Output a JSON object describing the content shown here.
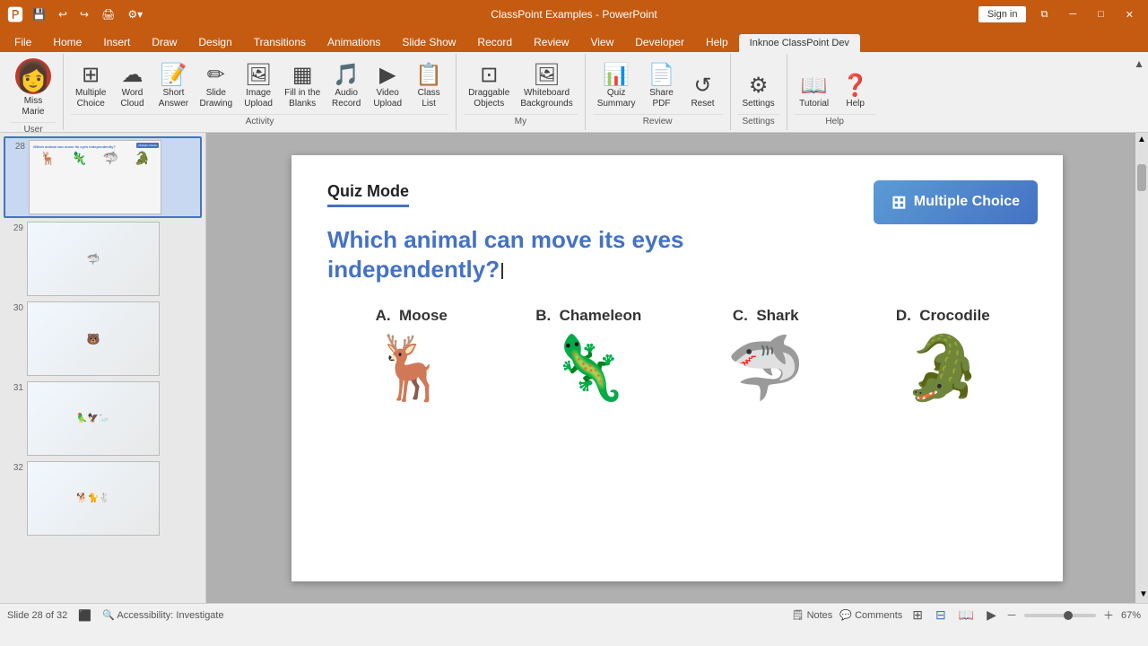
{
  "titleBar": {
    "appName": "ClassPoint Examples - PowerPoint",
    "signIn": "Sign in",
    "qatButtons": [
      "💾",
      "↩",
      "↪",
      "🖨",
      "⚙"
    ]
  },
  "ribbonTabs": [
    {
      "label": "File",
      "active": false
    },
    {
      "label": "Home",
      "active": false
    },
    {
      "label": "Insert",
      "active": false
    },
    {
      "label": "Draw",
      "active": false
    },
    {
      "label": "Design",
      "active": false
    },
    {
      "label": "Transitions",
      "active": false
    },
    {
      "label": "Animations",
      "active": false
    },
    {
      "label": "Slide Show",
      "active": false
    },
    {
      "label": "Record",
      "active": false
    },
    {
      "label": "Review",
      "active": false
    },
    {
      "label": "View",
      "active": false
    },
    {
      "label": "Developer",
      "active": false
    },
    {
      "label": "Help",
      "active": false
    },
    {
      "label": "Inknoe ClassPoint Dev",
      "active": true
    }
  ],
  "ribbonGroups": {
    "user": {
      "label": "User",
      "items": [
        {
          "icon": "👤",
          "label": "Miss\nMarie"
        }
      ]
    },
    "activity": {
      "label": "Activity",
      "items": [
        {
          "icon": "⊞",
          "label": "Multiple\nChoice"
        },
        {
          "icon": "☁",
          "label": "Word\nCloud"
        },
        {
          "icon": "📝",
          "label": "Short\nAnswer"
        },
        {
          "icon": "✏",
          "label": "Slide\nDrawing"
        },
        {
          "icon": "🖼",
          "label": "Image\nUpload"
        },
        {
          "icon": "▦",
          "label": "Fill in the\nBlanks"
        },
        {
          "icon": "🎵",
          "label": "Audio\nRecord"
        },
        {
          "icon": "▶",
          "label": "Video\nUpload"
        },
        {
          "icon": "📋",
          "label": "Class\nList"
        }
      ]
    },
    "my": {
      "label": "My",
      "items": [
        {
          "icon": "⊡",
          "label": "Draggable\nObjects"
        },
        {
          "icon": "🖼",
          "label": "Whiteboard\nBackgrounds"
        }
      ]
    },
    "review": {
      "label": "Review",
      "items": [
        {
          "icon": "📊",
          "label": "Quiz\nSummary"
        },
        {
          "icon": "📄",
          "label": "Share\nPDF"
        },
        {
          "icon": "↺",
          "label": "Reset"
        }
      ]
    },
    "settings": {
      "label": "Settings",
      "items": [
        {
          "icon": "⚙",
          "label": "Settings"
        }
      ]
    },
    "help": {
      "label": "Help",
      "items": [
        {
          "icon": "📖",
          "label": "Tutorial"
        },
        {
          "icon": "❓",
          "label": "Help"
        }
      ]
    }
  },
  "sectionLabels": {
    "user": "User",
    "activity": "Activity",
    "my": "My",
    "review": "Review",
    "settings": "Settings",
    "help": "Help"
  },
  "slides": [
    {
      "num": "28",
      "active": true
    },
    {
      "num": "29",
      "active": false
    },
    {
      "num": "30",
      "active": false
    },
    {
      "num": "31",
      "active": false
    },
    {
      "num": "32",
      "active": false
    }
  ],
  "slide": {
    "quizModeTitle": "Quiz Mode",
    "multipleChoiceBtn": "Multiple Choice",
    "question": "Which animal can move its eyes independently?",
    "cursor": true,
    "answers": [
      {
        "label": "A.  Moose",
        "emoji": "🦌"
      },
      {
        "label": "B.  Chameleon",
        "emoji": "🦎"
      },
      {
        "label": "C.  Shark",
        "emoji": "🦈"
      },
      {
        "label": "D.  Crocodile",
        "emoji": "🐊"
      }
    ]
  },
  "statusBar": {
    "slideInfo": "Slide 28 of 32",
    "accessibility": "🔍 Accessibility: Investigate",
    "notes": "🗒 Notes",
    "comments": "💬 Comments",
    "zoom": "67%"
  }
}
